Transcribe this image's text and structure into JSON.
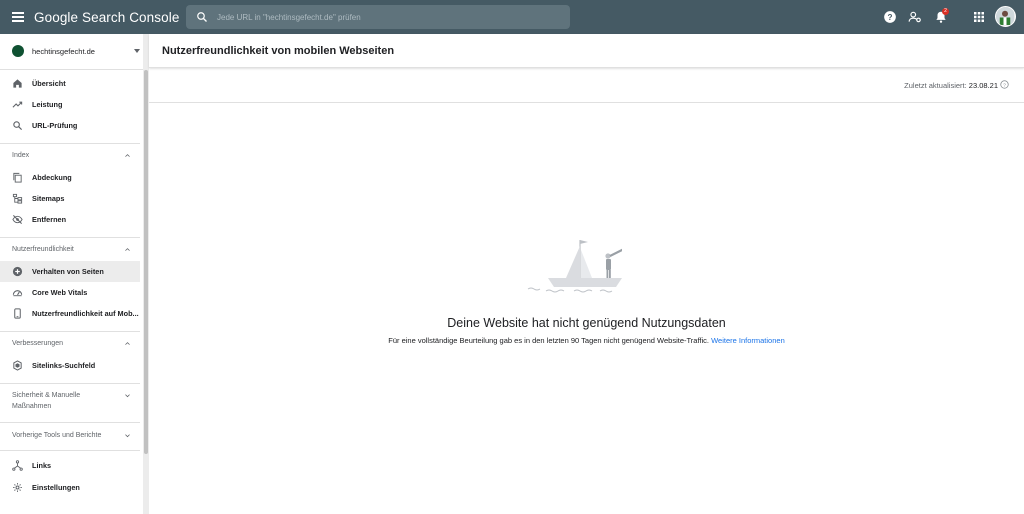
{
  "app": {
    "logo": "Google Search Console"
  },
  "search": {
    "placeholder": "Jede URL in \"hechtinsgefecht.de\" prüfen"
  },
  "topbar": {
    "icons": [
      "help-icon",
      "manage-users-icon",
      "notifications-icon",
      "apps-grid-icon",
      "avatar"
    ],
    "notification_count": "2"
  },
  "sidebar": {
    "property": "hechtinsgefecht.de",
    "top_items": [
      {
        "label": "Übersicht",
        "icon": "home-icon"
      },
      {
        "label": "Leistung",
        "icon": "trending-up-icon"
      },
      {
        "label": "URL-Prüfung",
        "icon": "search-icon"
      }
    ],
    "sections": {
      "index": {
        "label": "Index",
        "items": [
          {
            "label": "Abdeckung",
            "icon": "coverage-icon"
          },
          {
            "label": "Sitemaps",
            "icon": "sitemap-icon"
          },
          {
            "label": "Entfernen",
            "icon": "removals-icon"
          }
        ]
      },
      "mobile": {
        "label": "Nutzerfreundlichkeit",
        "items": [
          {
            "label": "Verhalten von Seiten",
            "icon": "plus-circle-icon"
          },
          {
            "label": "Core Web Vitals",
            "icon": "speedometer-icon"
          },
          {
            "label": "Nutzerfreundlichkeit auf Mob...",
            "icon": "smartphone-icon"
          }
        ]
      },
      "enhancements": {
        "label": "Verbesserungen",
        "items": [
          {
            "label": "Sitelinks-Suchfeld",
            "icon": "sitelinks-icon"
          }
        ]
      },
      "security": {
        "label_line1": "Sicherheit & Manuelle",
        "label_line2": "Maßnahmen"
      },
      "legacy": {
        "label": "Vorherige Tools und Berichte"
      }
    },
    "bottom_items": [
      {
        "label": "Links",
        "icon": "links-icon"
      },
      {
        "label": "Einstellungen",
        "icon": "settings-icon"
      }
    ]
  },
  "main": {
    "title": "Nutzerfreundlichkeit von mobilen Webseiten",
    "updated_label": "Zuletzt aktualisiert:",
    "updated_date": "23.08.21",
    "empty_title": "Deine Website hat nicht genügend Nutzungsdaten",
    "empty_text": "Für eine vollständige Beurteilung gab es in den letzten 90 Tagen nicht genügend Website-Traffic.",
    "empty_link": "Weitere Informationen"
  },
  "colors": {
    "topbar": "#455a64",
    "link": "#1a73e8",
    "badge": "#d93025",
    "active_item": "#ececec"
  }
}
